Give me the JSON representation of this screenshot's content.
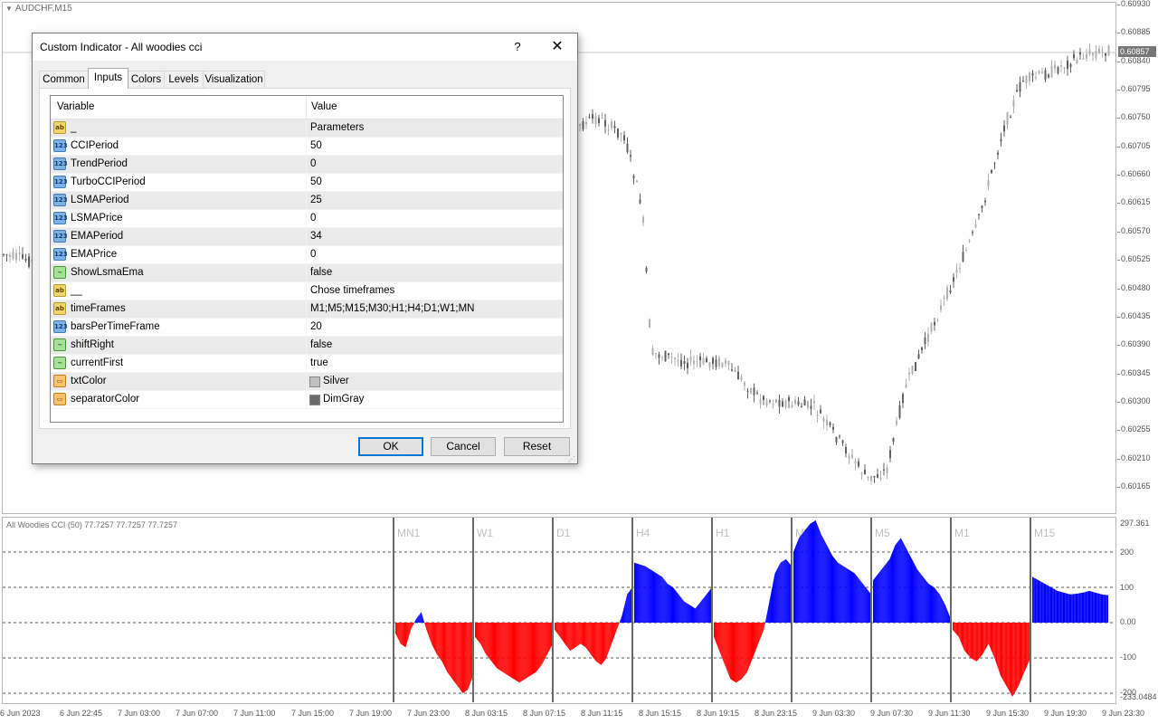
{
  "chart": {
    "symbol": "AUDCHF,M15",
    "current_price": "0.60857",
    "price_labels": [
      "0.60930",
      "0.60885",
      "0.60840",
      "0.60795",
      "0.60750",
      "0.60705",
      "0.60660",
      "0.60615",
      "0.60570",
      "0.60525",
      "0.60480",
      "0.60435",
      "0.60390",
      "0.60345",
      "0.60300",
      "0.60255",
      "0.60210",
      "0.60165"
    ]
  },
  "indicator": {
    "title": "All Woodies CCI (50) 77.7257 77.7257 77.7257",
    "scale_labels": [
      "297.361",
      "200",
      "100",
      "0.00",
      "-100",
      "-200",
      "-233.0484"
    ],
    "panels": [
      "MN1",
      "W1",
      "D1",
      "H4",
      "H1",
      "M30",
      "M5",
      "M1",
      "M15"
    ],
    "colors": {
      "positive": "#0000ff",
      "negative": "#ff0000",
      "separator": "#696969",
      "panel_text": "#c0c0c0"
    }
  },
  "time_axis": [
    "6 Jun 2023",
    "6 Jun 22:45",
    "7 Jun 03:00",
    "7 Jun 07:00",
    "7 Jun 11:00",
    "7 Jun 15:00",
    "7 Jun 19:00",
    "7 Jun 23:00",
    "8 Jun 03:15",
    "8 Jun 07:15",
    "8 Jun 11:15",
    "8 Jun 15:15",
    "8 Jun 19:15",
    "8 Jun 23:15",
    "9 Jun 03:30",
    "9 Jun 07:30",
    "9 Jun 11:30",
    "9 Jun 15:30",
    "9 Jun 19:30",
    "9 Jun 23:30"
  ],
  "dialog": {
    "title": "Custom Indicator - All woodies cci",
    "help": "?",
    "close": "✕",
    "tabs": [
      "Common",
      "Inputs",
      "Colors",
      "Levels",
      "Visualization"
    ],
    "active_tab": "Inputs",
    "columns": {
      "variable": "Variable",
      "value": "Value"
    },
    "rows": [
      {
        "type": "ab",
        "variable": "_",
        "value": "Parameters"
      },
      {
        "type": "num",
        "variable": "CCIPeriod",
        "value": "50"
      },
      {
        "type": "num",
        "variable": "TrendPeriod",
        "value": "0"
      },
      {
        "type": "num",
        "variable": "TurboCCIPeriod",
        "value": "50"
      },
      {
        "type": "num",
        "variable": "LSMAPeriod",
        "value": "25"
      },
      {
        "type": "num",
        "variable": "LSMAPrice",
        "value": "0"
      },
      {
        "type": "num",
        "variable": "EMAPeriod",
        "value": "34"
      },
      {
        "type": "num",
        "variable": "EMAPrice",
        "value": "0"
      },
      {
        "type": "bool",
        "variable": "ShowLsmaEma",
        "value": "false"
      },
      {
        "type": "ab",
        "variable": "__",
        "value": "Chose timeframes"
      },
      {
        "type": "ab",
        "variable": "timeFrames",
        "value": "M1;M5;M15;M30;H1;H4;D1;W1;MN"
      },
      {
        "type": "num",
        "variable": "barsPerTimeFrame",
        "value": "20"
      },
      {
        "type": "bool",
        "variable": "shiftRight",
        "value": "false"
      },
      {
        "type": "bool",
        "variable": "currentFirst",
        "value": "true"
      },
      {
        "type": "color",
        "variable": "txtColor",
        "value": "Silver",
        "swatch": "#c0c0c0"
      },
      {
        "type": "color",
        "variable": "separatorColor",
        "value": "DimGray",
        "swatch": "#696969"
      }
    ],
    "buttons": {
      "ok": "OK",
      "cancel": "Cancel",
      "reset": "Reset"
    }
  }
}
